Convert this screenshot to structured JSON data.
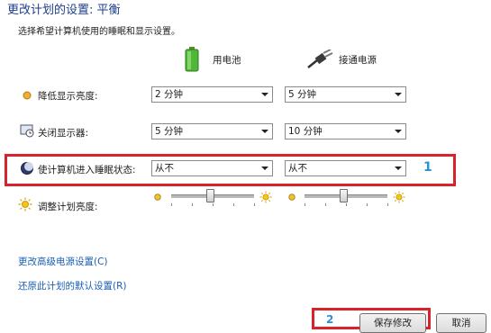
{
  "header": {
    "title": "更改计划的设置: 平衡",
    "subtitle": "选择希望计算机使用的睡眠和显示设置。"
  },
  "columns": {
    "battery_label": "用电池",
    "plugged_label": "接通电源"
  },
  "rows": {
    "dim": {
      "label": "降低显示亮度:",
      "battery": "2 分钟",
      "plugged": "5 分钟"
    },
    "display_off": {
      "label": "关闭显示器:",
      "battery": "5 分钟",
      "plugged": "10 分钟"
    },
    "sleep": {
      "label": "使计算机进入睡眠状态:",
      "battery": "从不",
      "plugged": "从不"
    },
    "brightness": {
      "label": "调整计划亮度:",
      "battery_level_fraction": 0.47,
      "plugged_level_fraction": 0.47
    }
  },
  "annotations": {
    "marker_1": "1",
    "marker_2": "2"
  },
  "links": {
    "advanced": "更改高级电源设置(C)",
    "restore": "还原此计划的默认设置(R)"
  },
  "footer": {
    "save_label": "保存修改",
    "cancel_label": "取消"
  },
  "colors": {
    "title": "#1f3e8a",
    "highlight_border": "#d8232a",
    "annotation": "#2d8fd6",
    "link": "#1a5fb4"
  },
  "icons": [
    "battery-icon",
    "power-plug-icon",
    "dim-brightness-icon",
    "monitor-clock-icon",
    "sleep-moon-icon",
    "brightness-sun-icon"
  ]
}
